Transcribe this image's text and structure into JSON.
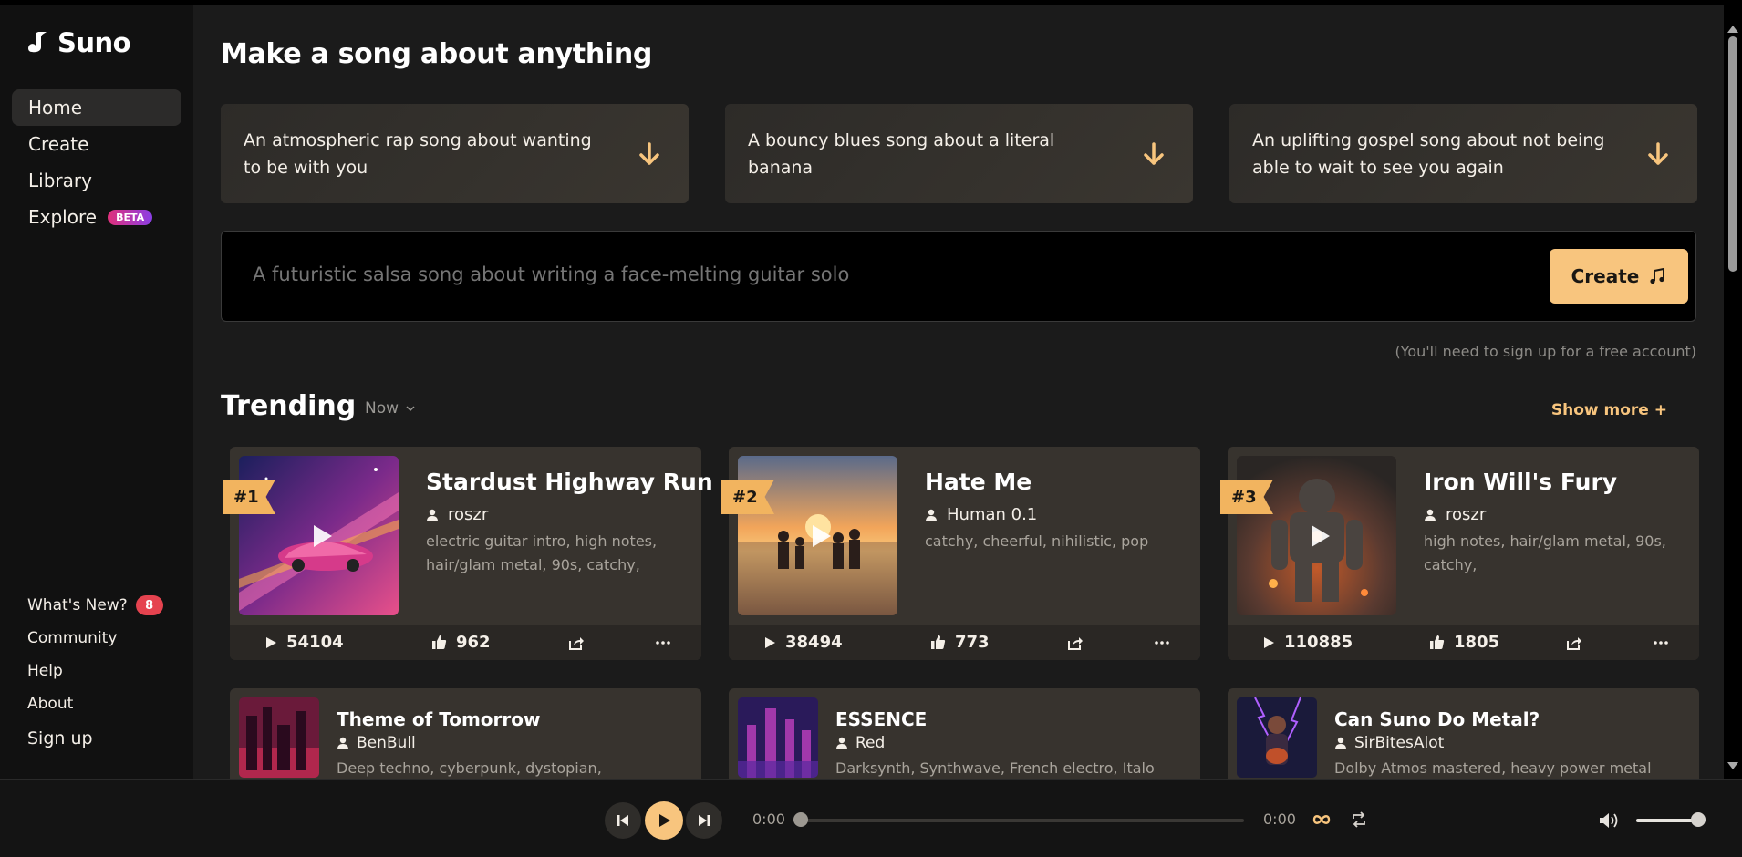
{
  "app": {
    "name": "Suno"
  },
  "sidebar": {
    "items": [
      {
        "label": "Home",
        "active": true
      },
      {
        "label": "Create"
      },
      {
        "label": "Library"
      },
      {
        "label": "Explore",
        "badge": "BETA"
      }
    ],
    "bottom": [
      {
        "label": "What's New?",
        "badge": "8"
      },
      {
        "label": "Community"
      },
      {
        "label": "Help"
      },
      {
        "label": "About"
      },
      {
        "label": "Sign up"
      }
    ]
  },
  "main": {
    "heading": "Make a song about anything",
    "suggestions": [
      "An atmospheric rap song about wanting to be with you",
      "A bouncy blues song about a literal banana",
      "An uplifting gospel song about not being able to wait to see you again"
    ],
    "prompt": {
      "placeholder": "A futuristic salsa song about writing a face-melting guitar solo",
      "value": ""
    },
    "create_label": "Create",
    "signup_note": "(You'll need to sign up for a free account)",
    "trending": {
      "title": "Trending",
      "filter": "Now",
      "show_more": "Show more +",
      "cards": [
        {
          "rank": "#1",
          "title": "Stardust Highway Run",
          "author": "roszr",
          "tags": "electric guitar intro, high notes, hair/glam metal, 90s, catchy,",
          "plays": "54104",
          "likes": "962"
        },
        {
          "rank": "#2",
          "title": "Hate Me",
          "author": "Human 0.1",
          "tags": "catchy, cheerful, nihilistic, pop",
          "plays": "38494",
          "likes": "773"
        },
        {
          "rank": "#3",
          "title": "Iron Will's Fury",
          "author": "roszr",
          "tags": "high notes, hair/glam metal, 90s, catchy,",
          "plays": "110885",
          "likes": "1805"
        }
      ]
    },
    "more_cards": [
      {
        "title": "Theme of Tomorrow",
        "author": "BenBull",
        "tags": "Deep techno, cyberpunk, dystopian,"
      },
      {
        "title": "ESSENCE",
        "author": "Red",
        "tags": "Darksynth, Synthwave, French electro, Italo"
      },
      {
        "title": "Can Suno Do Metal?",
        "author": "SirBitesAlot",
        "tags": "Dolby Atmos mastered, heavy power metal"
      }
    ]
  },
  "player": {
    "current_time": "0:00",
    "duration": "0:00",
    "progress": 0,
    "volume": 0.9
  },
  "colors": {
    "accent": "#f8c57e",
    "rank": "#f2b45f",
    "badge_red": "#e5434f",
    "card_bg": "#37332e"
  }
}
